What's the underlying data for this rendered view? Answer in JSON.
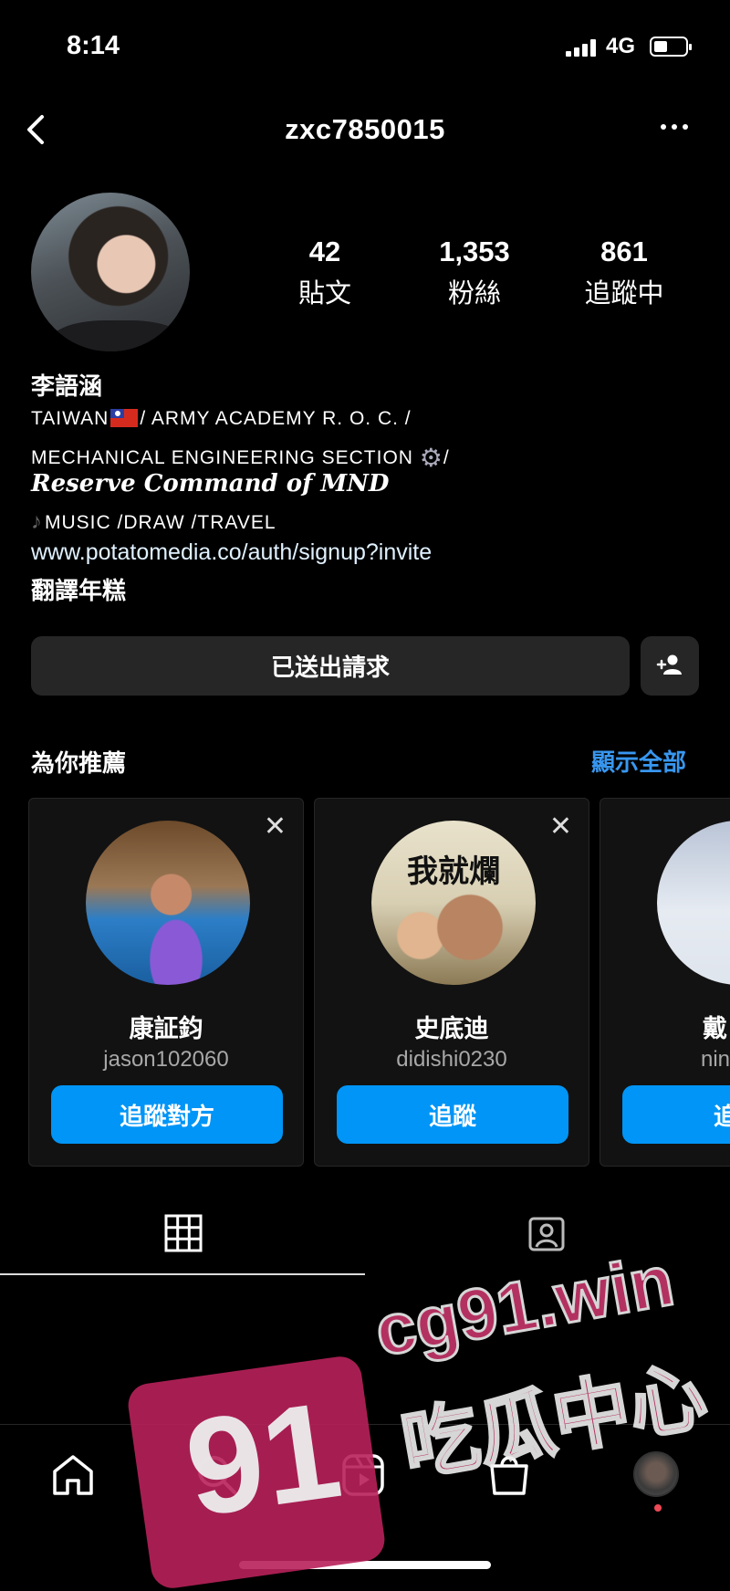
{
  "status": {
    "time": "8:14",
    "network": "4G"
  },
  "header": {
    "username": "zxc7850015"
  },
  "profile": {
    "full_name": "李語涵",
    "stats": [
      {
        "value": "42",
        "label": "貼文"
      },
      {
        "value": "1,353",
        "label": "粉絲"
      },
      {
        "value": "861",
        "label": "追蹤中"
      }
    ],
    "bio": {
      "line1_a": "TAIWAN",
      "line1_b": "/ ARMY ACADEMY R. O. C. /",
      "line2_a": "MECHANICAL ENGINEERING SECTION ",
      "line2_b": "/",
      "line3": "Reserve Command of MND",
      "line4": "MUSIC /DRAW /TRAVEL",
      "link": "www.potatomedia.co/auth/signup?invite",
      "line6": "翻譯年糕"
    }
  },
  "actions": {
    "requested_label": "已送出請求"
  },
  "suggestions": {
    "title": "為你推薦",
    "see_all": "顯示全部",
    "cards": [
      {
        "name": "康証鈞",
        "handle": "jason102060",
        "button": "追蹤對方"
      },
      {
        "name": "史底迪",
        "handle": "didishi0230",
        "button": "追蹤",
        "pic_text": "我就爛"
      },
      {
        "name": "戴",
        "handle": "ning",
        "button": "追"
      }
    ]
  },
  "watermark": {
    "badge": "91",
    "url": "cg91.win",
    "cn": "吃瓜中心"
  },
  "colors": {
    "accent": "#0095f6",
    "link_blue": "#3897f0",
    "surface": "#262626"
  }
}
